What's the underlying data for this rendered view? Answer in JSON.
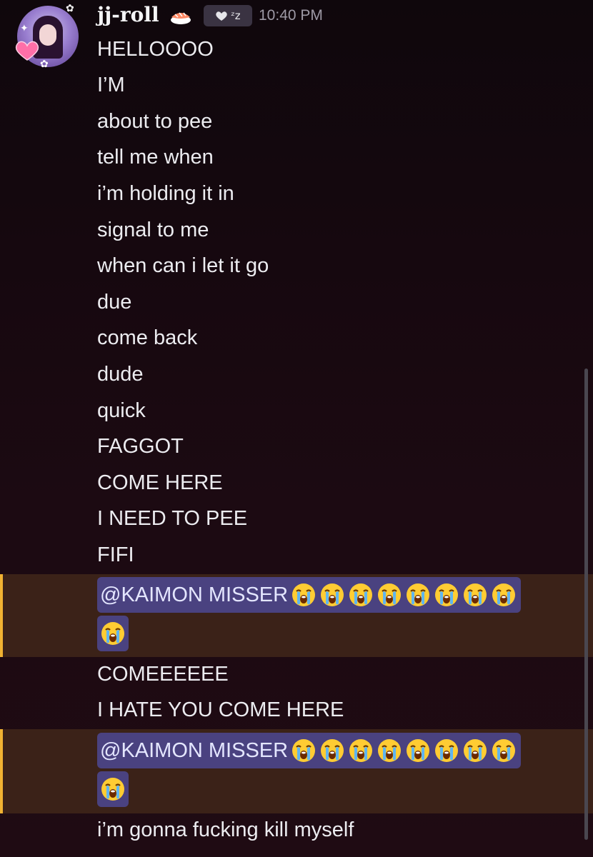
{
  "header": {
    "username": "jj-roll",
    "username_emoji": "sushi-icon",
    "status_label": "ᶻz",
    "timestamp": "10:40 PM"
  },
  "messages": [
    "HELLOOOO",
    "I’M",
    "about to pee",
    "tell me when",
    "i’m holding it in",
    "signal to me",
    "when can i let it go",
    "due",
    "come back",
    "dude",
    "quick",
    "FAGGOT",
    "COME HERE",
    "I NEED TO PEE",
    "FIFI"
  ],
  "mentions": [
    {
      "text": "@KAIMON MISSER",
      "emoji": "loudly-crying-face-icon",
      "emoji_count": 9
    },
    {
      "text": "@KAIMON MISSER",
      "emoji": "loudly-crying-face-icon",
      "emoji_count": 9
    }
  ],
  "messages_after_first_mention": [
    "COMEEEEEE",
    "I HATE YOU COME HERE"
  ],
  "messages_after_second_mention": [
    "i’m gonna fucking kill myself"
  ],
  "colors": {
    "background": "#1a0a10",
    "mention_highlight": "#3b2218",
    "mention_bar": "#f0b232",
    "mention_pill": "#4a4280",
    "timestamp": "#9d99a5"
  }
}
